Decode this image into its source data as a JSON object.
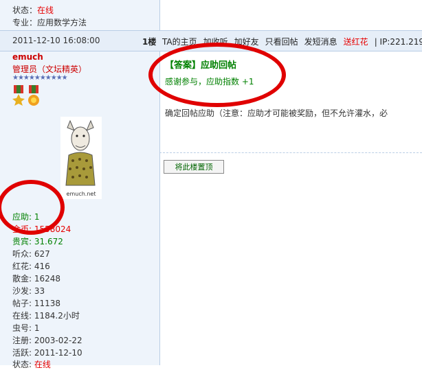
{
  "top": {
    "status_label": "状态：",
    "status_value": "在线",
    "major": "专业：应用数学方法"
  },
  "post_bar": {
    "date": "2011-12-10 16:08:00",
    "floor": "1楼",
    "links": [
      "TA的主页",
      "加收听",
      "加好友",
      "只看回帖",
      "发短消息"
    ],
    "red_link": "送红花",
    "ip": "| IP:221.219."
  },
  "user": {
    "name": "emuch",
    "role": "管理员（文坛精英）",
    "stars": "★★★★★★★★★★",
    "avatar_caption": "emuch.net"
  },
  "stats": [
    {
      "label": "应助: ",
      "value": "1",
      "color": "#008000"
    },
    {
      "label": "金币: ",
      "value": "1558024",
      "color": "#e60000"
    },
    {
      "label": "贵宾: ",
      "value": "31.672",
      "color": "#008000"
    },
    {
      "label": "听众: ",
      "value": "627",
      "color": "#333333"
    },
    {
      "label": "红花: ",
      "value": "416",
      "color": "#333333"
    },
    {
      "label": "散金: ",
      "value": "16248",
      "color": "#333333"
    },
    {
      "label": "沙发: ",
      "value": "33",
      "color": "#333333"
    },
    {
      "label": "帖子: ",
      "value": "11138",
      "color": "#333333"
    },
    {
      "label": "在线: ",
      "value": "1184.2小时",
      "color": "#333333"
    },
    {
      "label": "虫号: ",
      "value": "1",
      "color": "#333333"
    },
    {
      "label": "注册: ",
      "value": "2003-02-22",
      "color": "#333333"
    },
    {
      "label": "活跃: ",
      "value": "2011-12-10",
      "color": "#333333"
    },
    {
      "label": "状态: ",
      "value": "在线",
      "color": "#e60000"
    }
  ],
  "post": {
    "title": "【答案】应助回帖",
    "subtitle": "感谢参与，应助指数  +1",
    "body": "确定回帖应助（注意：应助才可能被奖励，但不允许灌水，必",
    "pin_button": "将此楼置顶"
  },
  "colors": {
    "annotation": "#e00000",
    "sidebar_bg": "#eef4fb",
    "bar_bg": "#e6eef8"
  }
}
